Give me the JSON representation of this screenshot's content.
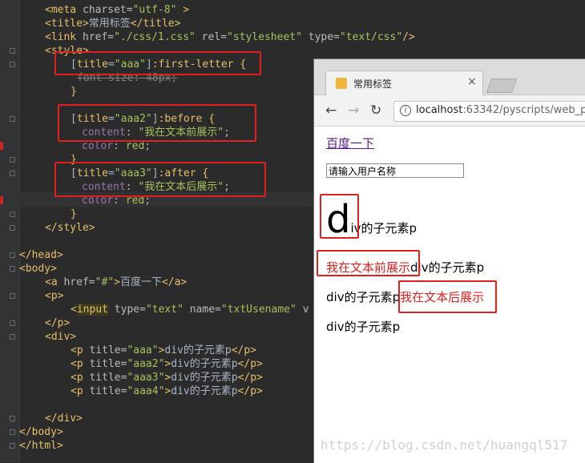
{
  "editor": {
    "lines": [
      {
        "parts": [
          {
            "c": "t",
            "s": "<meta"
          },
          {
            "c": "a",
            "s": " charset="
          },
          {
            "c": "v",
            "s": "\"utf-8\""
          },
          {
            "c": "t",
            "s": " >"
          }
        ]
      },
      {
        "parts": [
          {
            "c": "t",
            "s": "<title>"
          },
          {
            "c": "txt",
            "s": "常用标签"
          },
          {
            "c": "t",
            "s": "</title>"
          }
        ]
      },
      {
        "parts": [
          {
            "c": "t",
            "s": "<link"
          },
          {
            "c": "a",
            "s": " href="
          },
          {
            "c": "v",
            "s": "\"./css/1.css\""
          },
          {
            "c": "a",
            "s": " rel="
          },
          {
            "c": "v",
            "s": "\"stylesheet\""
          },
          {
            "c": "a",
            "s": " type="
          },
          {
            "c": "v",
            "s": "\"text/css\""
          },
          {
            "c": "t",
            "s": "/>"
          }
        ]
      },
      {
        "parts": [
          {
            "c": "t",
            "s": "<style>"
          }
        ]
      },
      {
        "parts": [
          {
            "c": "br",
            "s": "["
          },
          {
            "c": "sel",
            "s": "title"
          },
          {
            "c": "br",
            "s": "="
          },
          {
            "c": "pv",
            "s": "\"aaa\""
          },
          {
            "c": "br",
            "s": "]"
          },
          {
            "c": "sel",
            "s": ":first-letter {"
          }
        ]
      },
      {
        "parts": [
          {
            "c": "strk",
            "s": "font-size: 48px;"
          }
        ]
      },
      {
        "parts": [
          {
            "c": "sel",
            "s": "}"
          }
        ]
      },
      {
        "parts": []
      },
      {
        "parts": [
          {
            "c": "br",
            "s": "["
          },
          {
            "c": "sel",
            "s": "title"
          },
          {
            "c": "br",
            "s": "="
          },
          {
            "c": "pv",
            "s": "\"aaa2\""
          },
          {
            "c": "br",
            "s": "]"
          },
          {
            "c": "sel",
            "s": ":before {"
          }
        ]
      },
      {
        "parts": [
          {
            "c": "pn",
            "s": "content"
          },
          {
            "c": "txt",
            "s": ": "
          },
          {
            "c": "pv",
            "s": "\"我在文本前展示\""
          },
          {
            "c": "txt",
            "s": ";"
          }
        ]
      },
      {
        "parts": [
          {
            "c": "pn",
            "s": "color"
          },
          {
            "c": "txt",
            "s": ": "
          },
          {
            "c": "pv",
            "s": "red"
          },
          {
            "c": "txt",
            "s": ";"
          }
        ]
      },
      {
        "parts": [
          {
            "c": "sel",
            "s": "}"
          }
        ]
      },
      {
        "parts": [
          {
            "c": "br",
            "s": "["
          },
          {
            "c": "sel",
            "s": "title"
          },
          {
            "c": "br",
            "s": "="
          },
          {
            "c": "pv",
            "s": "\"aaa3\""
          },
          {
            "c": "br",
            "s": "]"
          },
          {
            "c": "sel",
            "s": ":after {"
          }
        ]
      },
      {
        "parts": [
          {
            "c": "pn",
            "s": "content"
          },
          {
            "c": "txt",
            "s": ": "
          },
          {
            "c": "pv",
            "s": "\"我在文本后展示\""
          },
          {
            "c": "txt",
            "s": ";"
          }
        ]
      },
      {
        "parts": [
          {
            "c": "pn",
            "s": "color"
          },
          {
            "c": "txt",
            "s": ": "
          },
          {
            "c": "pv",
            "s": "red"
          },
          {
            "c": "txt",
            "s": ";"
          }
        ]
      },
      {
        "parts": [
          {
            "c": "sel",
            "s": "}"
          }
        ]
      },
      {
        "parts": [
          {
            "c": "t",
            "s": "</style>"
          }
        ]
      },
      {
        "parts": []
      },
      {
        "parts": [
          {
            "c": "t",
            "s": "</head>"
          }
        ]
      },
      {
        "parts": [
          {
            "c": "t",
            "s": "<body>"
          }
        ]
      },
      {
        "parts": [
          {
            "c": "t",
            "s": "<a"
          },
          {
            "c": "a",
            "s": " href="
          },
          {
            "c": "v",
            "s": "\"#\""
          },
          {
            "c": "t",
            "s": ">"
          },
          {
            "c": "txt",
            "s": "百度一下"
          },
          {
            "c": "t",
            "s": "</a>"
          }
        ]
      },
      {
        "parts": [
          {
            "c": "t",
            "s": "<p>"
          }
        ]
      },
      {
        "parts": [
          {
            "c": "t",
            "s": "<"
          },
          {
            "c": "inputhl",
            "s": "input"
          },
          {
            "c": "a",
            "s": " type="
          },
          {
            "c": "v",
            "s": "\"text\""
          },
          {
            "c": "a",
            "s": " name="
          },
          {
            "c": "v",
            "s": "\"txtUsename\""
          },
          {
            "c": "a",
            "s": " v"
          }
        ]
      },
      {
        "parts": [
          {
            "c": "t",
            "s": "</p>"
          }
        ]
      },
      {
        "parts": [
          {
            "c": "t",
            "s": "<div>"
          }
        ]
      },
      {
        "parts": [
          {
            "c": "t",
            "s": "<p"
          },
          {
            "c": "a",
            "s": " title="
          },
          {
            "c": "v",
            "s": "\"aaa\""
          },
          {
            "c": "t",
            "s": ">"
          },
          {
            "c": "txt",
            "s": "div的子元素p"
          },
          {
            "c": "t",
            "s": "</p>"
          }
        ]
      },
      {
        "parts": [
          {
            "c": "t",
            "s": "<p"
          },
          {
            "c": "a",
            "s": " title="
          },
          {
            "c": "v",
            "s": "\"aaa2\""
          },
          {
            "c": "t",
            "s": ">"
          },
          {
            "c": "txt",
            "s": "div的子元素p"
          },
          {
            "c": "t",
            "s": "</p>"
          }
        ]
      },
      {
        "parts": [
          {
            "c": "t",
            "s": "<p"
          },
          {
            "c": "a",
            "s": " title="
          },
          {
            "c": "v",
            "s": "\"aaa3\""
          },
          {
            "c": "t",
            "s": ">"
          },
          {
            "c": "txt",
            "s": "div的子元素p"
          },
          {
            "c": "t",
            "s": "</p>"
          }
        ]
      },
      {
        "parts": [
          {
            "c": "t",
            "s": "<p"
          },
          {
            "c": "a",
            "s": " title="
          },
          {
            "c": "v",
            "s": "\"aaa4\""
          },
          {
            "c": "t",
            "s": ">"
          },
          {
            "c": "txt",
            "s": "div的子元素p"
          },
          {
            "c": "t",
            "s": "</p>"
          }
        ]
      },
      {
        "parts": []
      },
      {
        "parts": [
          {
            "c": "t",
            "s": "</div>"
          }
        ]
      },
      {
        "parts": [
          {
            "c": "t",
            "s": "</body>"
          }
        ]
      },
      {
        "parts": [
          {
            "c": "t",
            "s": "</html>"
          }
        ]
      }
    ]
  },
  "browser": {
    "tab_title": "常用标签",
    "tab_close": "×",
    "nav_back": "←",
    "nav_forward": "→",
    "nav_reload": "↻",
    "info_icon": "i",
    "url_host": "localhost",
    "url_path": ":63342/pyscripts/web_p"
  },
  "page": {
    "link_text": "百度一下",
    "input_value": "请输入用户名称",
    "p1_first_letter": "d",
    "p1_rest": "iv的子元素p",
    "p2_before": "我在文本前展示",
    "p2_text": "div的子元素p",
    "p3_text": "div的子元素p",
    "p3_after": "我在文本后展示",
    "p4_text": "div的子元素p"
  },
  "watermark": "https://blog.csdn.net/huangql517",
  "colors": {
    "editor_bg": "#2b2b2b",
    "tag": "#e8bf6a",
    "attr_value": "#a5c25c",
    "property": "#9876aa",
    "highlight_box": "#e02020",
    "pseudo_red": "#e02020"
  }
}
